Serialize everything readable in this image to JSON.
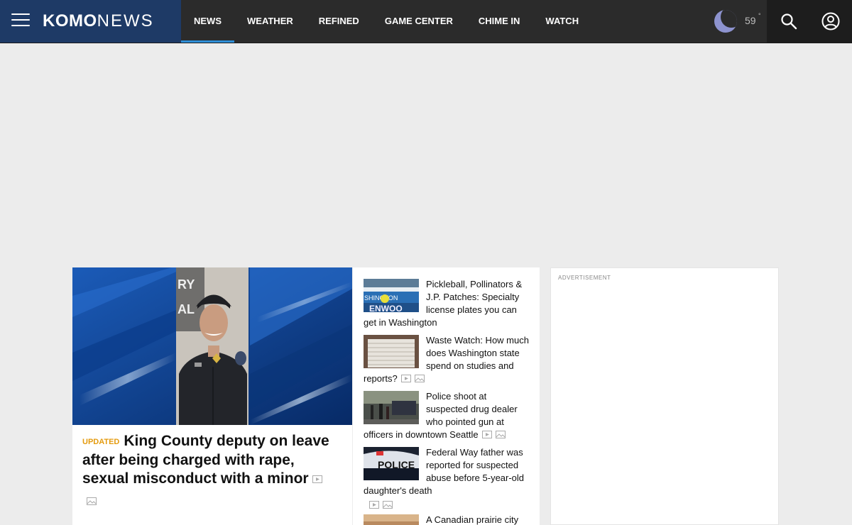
{
  "brand": {
    "logo_bold": "KOMO",
    "logo_light": "NEWS"
  },
  "nav": {
    "items": [
      {
        "label": "NEWS"
      },
      {
        "label": "WEATHER"
      },
      {
        "label": "REFINED"
      },
      {
        "label": "GAME CENTER"
      },
      {
        "label": "CHIME IN"
      },
      {
        "label": "WATCH"
      }
    ]
  },
  "weather": {
    "temp": "59",
    "degree": "°"
  },
  "lead": {
    "tag": "UPDATED",
    "title": "King County deputy on leave after being charged with rape, sexual misconduct with a minor"
  },
  "stories": [
    {
      "title": "Pickleball, Pollinators & J.P. Patches: Specialty license plates you can get in Washington"
    },
    {
      "title": "Waste Watch: How much does Washington state spend on studies and reports?"
    },
    {
      "title": "Police shoot at suspected drug dealer who pointed gun at officers in downtown Seattle"
    },
    {
      "title": "Federal Way father was reported for suspected abuse before 5-year-old daughter's death"
    },
    {
      "title": "A Canadian prairie city"
    }
  ],
  "side_ad": {
    "label": "ADVERTISEMENT"
  },
  "colors": {
    "brand_blue": "#1e3a66",
    "nav_active": "#2f8fd8",
    "updated": "#e49b0f"
  }
}
